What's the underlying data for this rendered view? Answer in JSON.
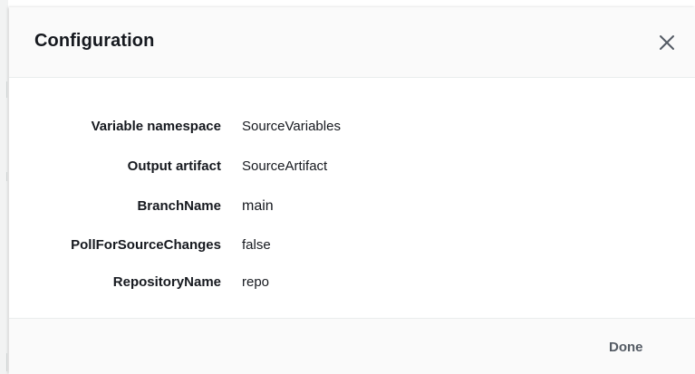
{
  "modal": {
    "title": "Configuration",
    "close_icon": "close-icon",
    "fields": [
      {
        "key": "Variable namespace",
        "value": "SourceVariables"
      },
      {
        "key": "Output artifact",
        "value": "SourceArtifact"
      },
      {
        "key": "BranchName",
        "value": "main"
      },
      {
        "key": "PollForSourceChanges",
        "value": "false"
      },
      {
        "key": "RepositoryName",
        "value": "repo"
      }
    ],
    "done_label": "Done"
  },
  "colors": {
    "text": "#16191f",
    "muted": "#545b64",
    "header_bg": "#fafafa",
    "divider": "#eaeded"
  }
}
